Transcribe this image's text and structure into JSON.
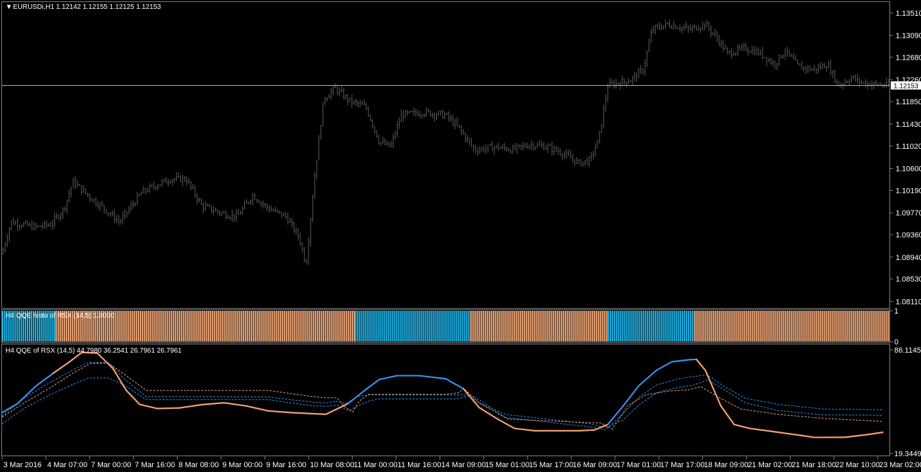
{
  "colors": {
    "background": "#000000",
    "frame": "#7f7f7f",
    "candle": "#5a5f5a",
    "text": "#ffffff",
    "price_line": "#b4b4b4",
    "histo_blue": "#1fb3e6",
    "histo_orange": "#f0a878",
    "rsx_up": "#3a8ff0",
    "rsx_down": "#f5a070",
    "level_blue": "#2e8ef0",
    "level_orange": "#f0a070"
  },
  "main": {
    "title": "EURUSDi,H1  1.12142 1.12155 1.12125 1.12153",
    "title_icon": "triangle-down-icon",
    "current_price_label": "1.12153",
    "y_ticks": [
      "1.13510",
      "1.13090",
      "1.12680",
      "1.12260",
      "1.11850",
      "1.11430",
      "1.11020",
      "1.10600",
      "1.10190",
      "1.09770",
      "1.09360",
      "1.08940",
      "1.08530",
      "1.08110"
    ]
  },
  "histo": {
    "title": "H4 QQE histo of RSX (14,5) 1.0000",
    "y_ticks": [
      "1",
      "0"
    ]
  },
  "qqe": {
    "title": "H4 QQE of RSX (14,5) 44.7980 36.2541 26.7961 26.7961",
    "y_ticks": [
      "86.1145",
      "19.3449"
    ]
  },
  "x_ticks": [
    "3 Mar 2016",
    "4 Mar 07:00",
    "7 Mar 00:00",
    "7 Mar 16:00",
    "8 Mar 08:00",
    "9 Mar 00:00",
    "9 Mar 16:00",
    "10 Mar 08:00",
    "11 Mar 00:00",
    "11 Mar 16:00",
    "14 Mar 09:00",
    "15 Mar 01:00",
    "15 Mar 17:00",
    "16 Mar 09:00",
    "17 Mar 01:00",
    "17 Mar 17:00",
    "18 Mar 09:00",
    "21 Mar 02:00",
    "21 Mar 18:00",
    "22 Mar 10:00",
    "23 Mar 02:00"
  ],
  "chart_data": [
    {
      "type": "candlestick",
      "title": "EURUSDi,H1",
      "ylim": [
        1.08,
        1.137
      ],
      "current_price": 1.12153,
      "close_path": [
        {
          "x": 0,
          "price": 1.09
        },
        {
          "x": 0.4,
          "price": 1.096
        },
        {
          "x": 1.5,
          "price": 1.095
        },
        {
          "x": 2.2,
          "price": 1.0955
        },
        {
          "x": 2.8,
          "price": 1.0985
        },
        {
          "x": 3.2,
          "price": 1.1035
        },
        {
          "x": 4.0,
          "price": 1.1005
        },
        {
          "x": 4.6,
          "price": 1.0985
        },
        {
          "x": 5.3,
          "price": 1.096
        },
        {
          "x": 6.3,
          "price": 1.1015
        },
        {
          "x": 7.0,
          "price": 1.103
        },
        {
          "x": 7.6,
          "price": 1.104
        },
        {
          "x": 8.3,
          "price": 1.104
        },
        {
          "x": 9.0,
          "price": 1.099
        },
        {
          "x": 10.0,
          "price": 1.0975
        },
        {
          "x": 10.6,
          "price": 1.097
        },
        {
          "x": 11.3,
          "price": 1.101
        },
        {
          "x": 12.0,
          "price": 1.0985
        },
        {
          "x": 12.8,
          "price": 1.097
        },
        {
          "x": 13.4,
          "price": 1.093
        },
        {
          "x": 13.7,
          "price": 1.088
        },
        {
          "x": 14.1,
          "price": 1.105
        },
        {
          "x": 14.5,
          "price": 1.119
        },
        {
          "x": 15.0,
          "price": 1.121
        },
        {
          "x": 15.7,
          "price": 1.1185
        },
        {
          "x": 16.4,
          "price": 1.1175
        },
        {
          "x": 17.0,
          "price": 1.111
        },
        {
          "x": 17.5,
          "price": 1.11
        },
        {
          "x": 18.0,
          "price": 1.116
        },
        {
          "x": 19.0,
          "price": 1.1165
        },
        {
          "x": 20.0,
          "price": 1.116
        },
        {
          "x": 20.6,
          "price": 1.1135
        },
        {
          "x": 21.3,
          "price": 1.1095
        },
        {
          "x": 22.3,
          "price": 1.11
        },
        {
          "x": 23.0,
          "price": 1.1095
        },
        {
          "x": 23.8,
          "price": 1.1105
        },
        {
          "x": 24.6,
          "price": 1.11
        },
        {
          "x": 25.2,
          "price": 1.109
        },
        {
          "x": 26.0,
          "price": 1.107
        },
        {
          "x": 26.5,
          "price": 1.1075
        },
        {
          "x": 26.9,
          "price": 1.1115
        },
        {
          "x": 27.3,
          "price": 1.1215
        },
        {
          "x": 28.3,
          "price": 1.1225
        },
        {
          "x": 28.9,
          "price": 1.1245
        },
        {
          "x": 29.3,
          "price": 1.132
        },
        {
          "x": 30.0,
          "price": 1.133
        },
        {
          "x": 31.0,
          "price": 1.132
        },
        {
          "x": 31.7,
          "price": 1.133
        },
        {
          "x": 32.3,
          "price": 1.13
        },
        {
          "x": 32.7,
          "price": 1.1275
        },
        {
          "x": 33.5,
          "price": 1.1285
        },
        {
          "x": 34.2,
          "price": 1.1275
        },
        {
          "x": 34.8,
          "price": 1.1255
        },
        {
          "x": 35.3,
          "price": 1.128
        },
        {
          "x": 35.9,
          "price": 1.125
        },
        {
          "x": 36.6,
          "price": 1.1245
        },
        {
          "x": 37.2,
          "price": 1.1255
        },
        {
          "x": 37.7,
          "price": 1.1215
        },
        {
          "x": 38.3,
          "price": 1.123
        },
        {
          "x": 38.8,
          "price": 1.122
        },
        {
          "x": 39.8,
          "price": 1.1215
        }
      ]
    },
    {
      "type": "bar",
      "title": "H4 QQE histo of RSX (14,5)",
      "ylim": [
        0,
        1
      ],
      "segments": [
        {
          "from": 0,
          "to": 2.4,
          "color": "blue"
        },
        {
          "from": 2.4,
          "to": 15.9,
          "color": "orange"
        },
        {
          "from": 15.9,
          "to": 21.1,
          "color": "blue"
        },
        {
          "from": 21.1,
          "to": 27.3,
          "color": "orange"
        },
        {
          "from": 27.3,
          "to": 31.2,
          "color": "blue"
        },
        {
          "from": 31.2,
          "to": 40,
          "color": "orange"
        }
      ]
    },
    {
      "type": "line",
      "title": "H4 QQE of RSX (14,5)",
      "ylim": [
        19.3449,
        86.1145
      ],
      "series": [
        {
          "points": [
            {
              "x": 0,
              "y": 45.7
            },
            {
              "x": 0.7,
              "y": 51.5
            },
            {
              "x": 1.5,
              "y": 62.5
            },
            {
              "x": 2.3,
              "y": 71.0
            },
            {
              "x": 3.0,
              "y": 78.0
            },
            {
              "x": 3.6,
              "y": 84.5
            },
            {
              "x": 4.3,
              "y": 84.0
            },
            {
              "x": 5.0,
              "y": 74.0
            },
            {
              "x": 5.6,
              "y": 60.0
            },
            {
              "x": 6.2,
              "y": 51.0
            },
            {
              "x": 7.0,
              "y": 48.3
            },
            {
              "x": 8.0,
              "y": 48.7
            },
            {
              "x": 9.0,
              "y": 50.8
            },
            {
              "x": 10.0,
              "y": 52.0
            },
            {
              "x": 11.0,
              "y": 50.0
            },
            {
              "x": 12.0,
              "y": 46.8
            },
            {
              "x": 13.0,
              "y": 45.7
            },
            {
              "x": 14.0,
              "y": 45.0
            },
            {
              "x": 14.6,
              "y": 44.6
            },
            {
              "x": 15.6,
              "y": 51.5
            },
            {
              "x": 16.3,
              "y": 59.5
            },
            {
              "x": 17.0,
              "y": 67.0
            },
            {
              "x": 17.8,
              "y": 69.5
            },
            {
              "x": 18.8,
              "y": 69.5
            },
            {
              "x": 20.0,
              "y": 67.5
            },
            {
              "x": 20.8,
              "y": 61.0
            },
            {
              "x": 21.5,
              "y": 49.0
            },
            {
              "x": 22.4,
              "y": 41.0
            },
            {
              "x": 23.1,
              "y": 35.5
            },
            {
              "x": 24.0,
              "y": 34.0
            },
            {
              "x": 26.0,
              "y": 34.0
            },
            {
              "x": 26.7,
              "y": 34.5
            },
            {
              "x": 27.3,
              "y": 38.0
            },
            {
              "x": 28.0,
              "y": 50.0
            },
            {
              "x": 28.7,
              "y": 63.0
            },
            {
              "x": 29.5,
              "y": 73.0
            },
            {
              "x": 30.2,
              "y": 78.5
            },
            {
              "x": 31.0,
              "y": 79.8
            },
            {
              "x": 31.3,
              "y": 80.0
            },
            {
              "x": 31.7,
              "y": 73.0
            },
            {
              "x": 32.4,
              "y": 50.0
            },
            {
              "x": 33.0,
              "y": 38.0
            },
            {
              "x": 33.7,
              "y": 35.5
            },
            {
              "x": 35.0,
              "y": 33.0
            },
            {
              "x": 36.0,
              "y": 31.0
            },
            {
              "x": 36.6,
              "y": 29.7
            },
            {
              "x": 38.0,
              "y": 29.8
            },
            {
              "x": 39.0,
              "y": 31.5
            },
            {
              "x": 39.7,
              "y": 33.0
            }
          ]
        },
        {
          "points": [
            {
              "x": 0,
              "y": 42.7
            },
            {
              "x": 1.0,
              "y": 52.0
            },
            {
              "x": 2.2,
              "y": 62.0
            },
            {
              "x": 3.3,
              "y": 72.0
            },
            {
              "x": 4.0,
              "y": 77.5
            },
            {
              "x": 4.8,
              "y": 77.5
            },
            {
              "x": 5.5,
              "y": 70.5
            },
            {
              "x": 6.5,
              "y": 60.0
            },
            {
              "x": 12.0,
              "y": 60.0
            },
            {
              "x": 13.0,
              "y": 58.0
            },
            {
              "x": 14.0,
              "y": 56.0
            },
            {
              "x": 14.6,
              "y": 55.2
            },
            {
              "x": 15.1,
              "y": 55.2
            },
            {
              "x": 15.4,
              "y": 50.0
            },
            {
              "x": 15.8,
              "y": 46.0
            },
            {
              "x": 16.1,
              "y": 53.0
            },
            {
              "x": 16.5,
              "y": 57.5
            },
            {
              "x": 20.0,
              "y": 57.5
            },
            {
              "x": 20.6,
              "y": 58.5
            },
            {
              "x": 20.8,
              "y": 61.5
            },
            {
              "x": 21.5,
              "y": 52.0
            },
            {
              "x": 22.8,
              "y": 41.5
            },
            {
              "x": 26.5,
              "y": 39.2
            },
            {
              "x": 27.0,
              "y": 39.0
            },
            {
              "x": 27.5,
              "y": 35.0
            },
            {
              "x": 28.2,
              "y": 50.0
            },
            {
              "x": 29.0,
              "y": 57.0
            },
            {
              "x": 30.0,
              "y": 59.5
            },
            {
              "x": 31.0,
              "y": 60.5
            },
            {
              "x": 31.5,
              "y": 62.5
            },
            {
              "x": 32.3,
              "y": 55.5
            },
            {
              "x": 33.3,
              "y": 48.0
            },
            {
              "x": 35.0,
              "y": 44.5
            },
            {
              "x": 37.0,
              "y": 42.0
            },
            {
              "x": 39.7,
              "y": 40.0
            }
          ]
        },
        {
          "points": [
            {
              "x": 0,
              "y": 38.5
            },
            {
              "x": 1.0,
              "y": 48.5
            },
            {
              "x": 2.2,
              "y": 57.5
            },
            {
              "x": 3.3,
              "y": 64.5
            },
            {
              "x": 3.9,
              "y": 68.0
            },
            {
              "x": 4.8,
              "y": 68.0
            },
            {
              "x": 5.5,
              "y": 63.5
            },
            {
              "x": 6.5,
              "y": 54.0
            },
            {
              "x": 12.0,
              "y": 54.0
            },
            {
              "x": 13.0,
              "y": 52.0
            },
            {
              "x": 14.0,
              "y": 50.0
            },
            {
              "x": 14.6,
              "y": 49.8
            },
            {
              "x": 15.1,
              "y": 50.5
            },
            {
              "x": 15.6,
              "y": 47.0
            },
            {
              "x": 16.5,
              "y": 53.0
            },
            {
              "x": 17.0,
              "y": 54.5
            },
            {
              "x": 20.5,
              "y": 54.5
            },
            {
              "x": 21.0,
              "y": 56.5
            },
            {
              "x": 21.5,
              "y": 52.0
            },
            {
              "x": 22.7,
              "y": 44.5
            },
            {
              "x": 26.5,
              "y": 38.5
            },
            {
              "x": 27.2,
              "y": 36.0
            },
            {
              "x": 28.0,
              "y": 41.0
            },
            {
              "x": 28.7,
              "y": 50.5
            },
            {
              "x": 29.5,
              "y": 58.5
            },
            {
              "x": 30.5,
              "y": 62.0
            },
            {
              "x": 31.2,
              "y": 63.5
            },
            {
              "x": 31.8,
              "y": 66.8
            },
            {
              "x": 32.5,
              "y": 61.0
            },
            {
              "x": 33.5,
              "y": 52.0
            },
            {
              "x": 35.0,
              "y": 47.0
            },
            {
              "x": 37.0,
              "y": 44.2
            },
            {
              "x": 39.7,
              "y": 44.0
            }
          ]
        },
        {
          "points": [
            {
              "x": 0,
              "y": 43.5
            },
            {
              "x": 1.0,
              "y": 55.0
            },
            {
              "x": 2.2,
              "y": 65.5
            },
            {
              "x": 3.3,
              "y": 74.0
            },
            {
              "x": 3.9,
              "y": 78.0
            },
            {
              "x": 4.8,
              "y": 78.0
            },
            {
              "x": 5.5,
              "y": 67.5
            },
            {
              "x": 6.5,
              "y": 56.0
            },
            {
              "x": 12.0,
              "y": 55.8
            },
            {
              "x": 13.0,
              "y": 54.0
            },
            {
              "x": 14.0,
              "y": 52.5
            },
            {
              "x": 14.6,
              "y": 52.0
            },
            {
              "x": 15.1,
              "y": 53.0
            },
            {
              "x": 15.5,
              "y": 51.5
            },
            {
              "x": 16.0,
              "y": 56.0
            },
            {
              "x": 16.5,
              "y": 57.0
            },
            {
              "x": 20.5,
              "y": 57.0
            },
            {
              "x": 21.0,
              "y": 57.5
            },
            {
              "x": 21.5,
              "y": 54.0
            },
            {
              "x": 22.7,
              "y": 42.5
            },
            {
              "x": 26.5,
              "y": 36.5
            },
            {
              "x": 27.2,
              "y": 34.5
            },
            {
              "x": 28.0,
              "y": 45.0
            },
            {
              "x": 28.7,
              "y": 55.5
            },
            {
              "x": 29.5,
              "y": 63.5
            },
            {
              "x": 30.5,
              "y": 67.5
            },
            {
              "x": 31.2,
              "y": 69.0
            },
            {
              "x": 31.8,
              "y": 70.0
            },
            {
              "x": 32.5,
              "y": 63.0
            },
            {
              "x": 33.5,
              "y": 55.0
            },
            {
              "x": 35.0,
              "y": 51.0
            },
            {
              "x": 37.0,
              "y": 48.0
            },
            {
              "x": 39.7,
              "y": 47.5
            }
          ]
        }
      ]
    }
  ]
}
